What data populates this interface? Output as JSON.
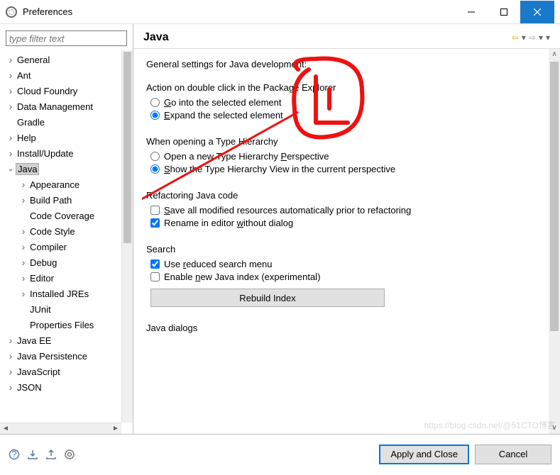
{
  "window": {
    "title": "Preferences"
  },
  "filter": {
    "placeholder": "type filter text"
  },
  "tree": [
    {
      "label": "General",
      "depth": 0,
      "expand": "right"
    },
    {
      "label": "Ant",
      "depth": 0,
      "expand": "right"
    },
    {
      "label": "Cloud Foundry",
      "depth": 0,
      "expand": "right"
    },
    {
      "label": "Data Management",
      "depth": 0,
      "expand": "right"
    },
    {
      "label": "Gradle",
      "depth": 0,
      "expand": "none"
    },
    {
      "label": "Help",
      "depth": 0,
      "expand": "right"
    },
    {
      "label": "Install/Update",
      "depth": 0,
      "expand": "right"
    },
    {
      "label": "Java",
      "depth": 0,
      "expand": "down",
      "selected": true
    },
    {
      "label": "Appearance",
      "depth": 1,
      "expand": "right"
    },
    {
      "label": "Build Path",
      "depth": 1,
      "expand": "right"
    },
    {
      "label": "Code Coverage",
      "depth": 1,
      "expand": "none"
    },
    {
      "label": "Code Style",
      "depth": 1,
      "expand": "right"
    },
    {
      "label": "Compiler",
      "depth": 1,
      "expand": "right"
    },
    {
      "label": "Debug",
      "depth": 1,
      "expand": "right"
    },
    {
      "label": "Editor",
      "depth": 1,
      "expand": "right"
    },
    {
      "label": "Installed JREs",
      "depth": 1,
      "expand": "right"
    },
    {
      "label": "JUnit",
      "depth": 1,
      "expand": "none"
    },
    {
      "label": "Properties Files",
      "depth": 1,
      "expand": "none"
    },
    {
      "label": "Java EE",
      "depth": 0,
      "expand": "right"
    },
    {
      "label": "Java Persistence",
      "depth": 0,
      "expand": "right"
    },
    {
      "label": "JavaScript",
      "depth": 0,
      "expand": "right"
    },
    {
      "label": "JSON",
      "depth": 0,
      "expand": "right"
    }
  ],
  "page": {
    "title": "Java",
    "desc": "General settings for Java development:",
    "group1": {
      "title": "Action on double click in the Package Explorer",
      "opt1": "Go into the selected element",
      "opt2": "Expand the selected element"
    },
    "group2": {
      "title": "When opening a Type Hierarchy",
      "opt1": "Open a new Type Hierarchy Perspective",
      "opt2": "Show the Type Hierarchy View in the current perspective"
    },
    "group3": {
      "title": "Refactoring Java code",
      "opt1": "Save all modified resources automatically prior to refactoring",
      "opt2": "Rename in editor without dialog"
    },
    "group4": {
      "title": "Search",
      "opt1": "Use reduced search menu",
      "opt2": "Enable new Java index (experimental)",
      "rebuild": "Rebuild Index"
    },
    "group5": {
      "title": "Java dialogs"
    }
  },
  "footer": {
    "apply": "Apply and Close",
    "cancel": "Cancel"
  },
  "watermark": "https://blog.csdn.net/@51CTO博客"
}
